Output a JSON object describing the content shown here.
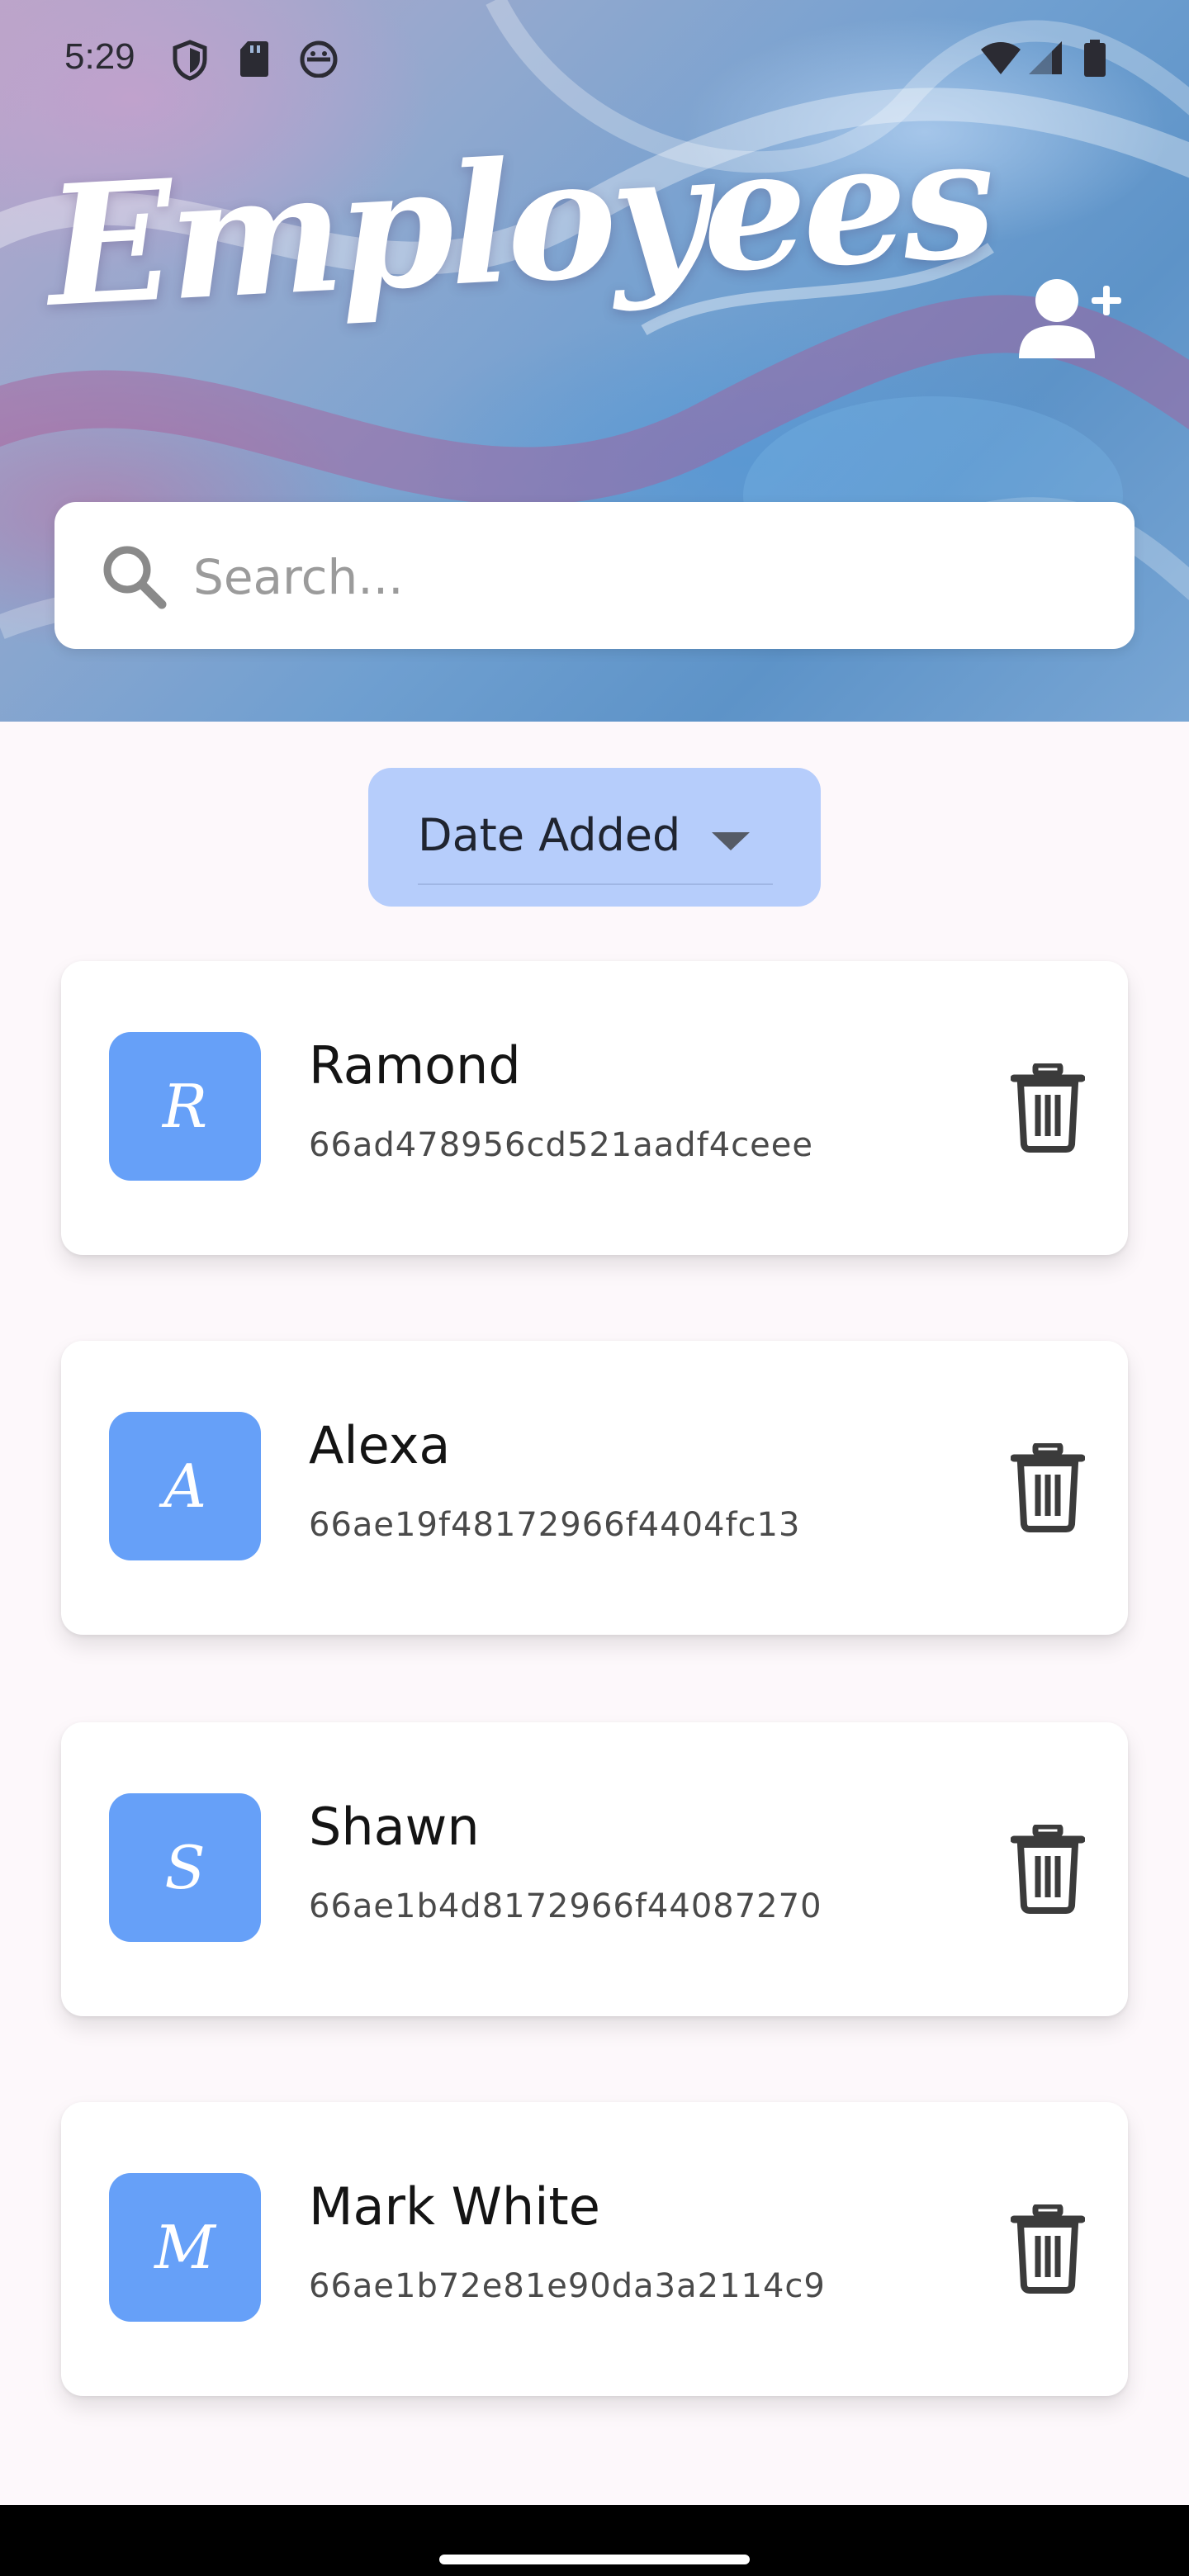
{
  "status_bar": {
    "time": "5:29",
    "left_icons": [
      "shield-icon",
      "sd-card-icon",
      "android-debug-icon"
    ],
    "right_icons": [
      "wifi-icon",
      "signal-icon",
      "battery-icon"
    ]
  },
  "header": {
    "title": "Employees",
    "add_icon": "add-user-icon"
  },
  "search": {
    "placeholder": "Search...",
    "value": ""
  },
  "sort": {
    "selected": "Date Added"
  },
  "employees": [
    {
      "initial": "R",
      "name": "Ramond",
      "id": "66ad478956cd521aadf4ceee"
    },
    {
      "initial": "A",
      "name": "Alexa",
      "id": "66ae19f48172966f4404fc13"
    },
    {
      "initial": "S",
      "name": "Shawn",
      "id": "66ae1b4d8172966f44087270"
    },
    {
      "initial": "M",
      "name": "Mark White",
      "id": "66ae1b72e81e90da3a2114c9"
    }
  ],
  "colors": {
    "avatar_bg": "#66a0f8",
    "sort_chip_bg": "#b6cdfb",
    "page_bg": "#fdf8fb"
  }
}
